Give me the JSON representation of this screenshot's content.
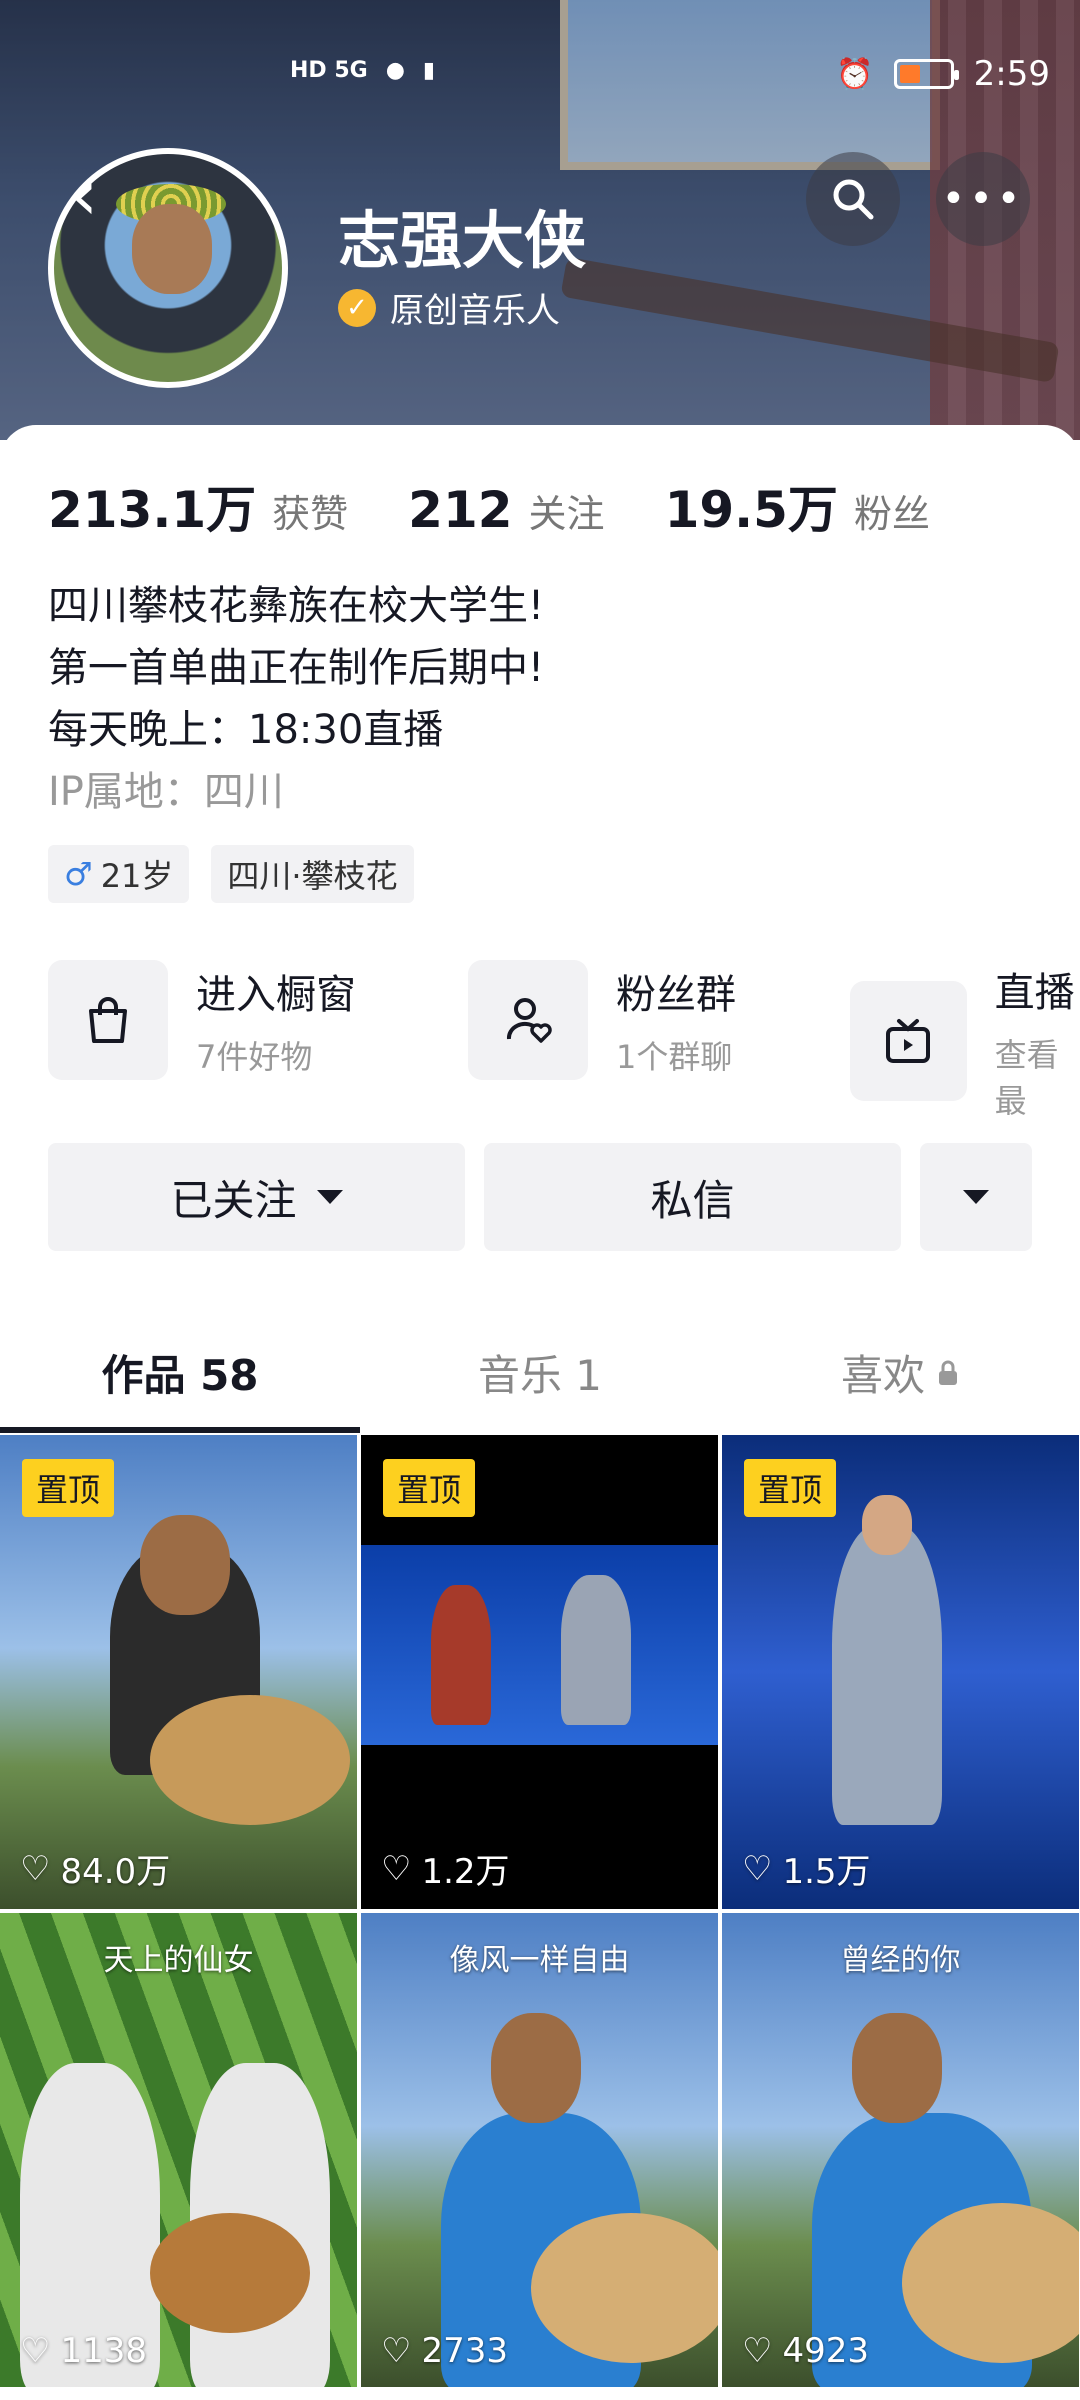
{
  "status": {
    "signal": "HD 5G",
    "time": "2:59"
  },
  "profile": {
    "name": "志强大侠",
    "badge": "原创音乐人"
  },
  "stats": [
    {
      "num": "213.1万",
      "label": "获赞"
    },
    {
      "num": "212",
      "label": "关注"
    },
    {
      "num": "19.5万",
      "label": "粉丝"
    }
  ],
  "bio": {
    "line1": "四川攀枝花彝族在校大学生!",
    "line2": "第一首单曲正在制作后期中!",
    "line3": "每天晚上：18:30直播",
    "ip": "IP属地：四川"
  },
  "tags": {
    "age": "21岁",
    "location": "四川·攀枝花",
    "male_symbol": "♂"
  },
  "entries": [
    {
      "title": "进入橱窗",
      "sub": "7件好物",
      "icon": "shopping-bag-icon"
    },
    {
      "title": "粉丝群",
      "sub": "1个群聊",
      "icon": "fan-group-icon"
    },
    {
      "title": "直播",
      "sub": "查看最",
      "icon": "tv-icon"
    }
  ],
  "actions": {
    "follow": "已关注",
    "message": "私信"
  },
  "tabs": [
    {
      "label": "作品 58"
    },
    {
      "label": "音乐 1"
    },
    {
      "label": "喜欢"
    }
  ],
  "videos": [
    {
      "pinned": "置顶",
      "likes": "84.0万",
      "caption": ""
    },
    {
      "pinned": "置顶",
      "likes": "1.2万",
      "caption": ""
    },
    {
      "pinned": "置顶",
      "likes": "1.5万",
      "caption": ""
    },
    {
      "pinned": "",
      "likes": "1138",
      "caption": "天上的仙女"
    },
    {
      "pinned": "",
      "likes": "2733",
      "caption": "像风一样自由"
    },
    {
      "pinned": "",
      "likes": "4923",
      "caption": "曾经的你"
    }
  ],
  "colors": {
    "accent_yellow": "#fdd01f",
    "verify": "#f7b731",
    "text": "#161823"
  }
}
